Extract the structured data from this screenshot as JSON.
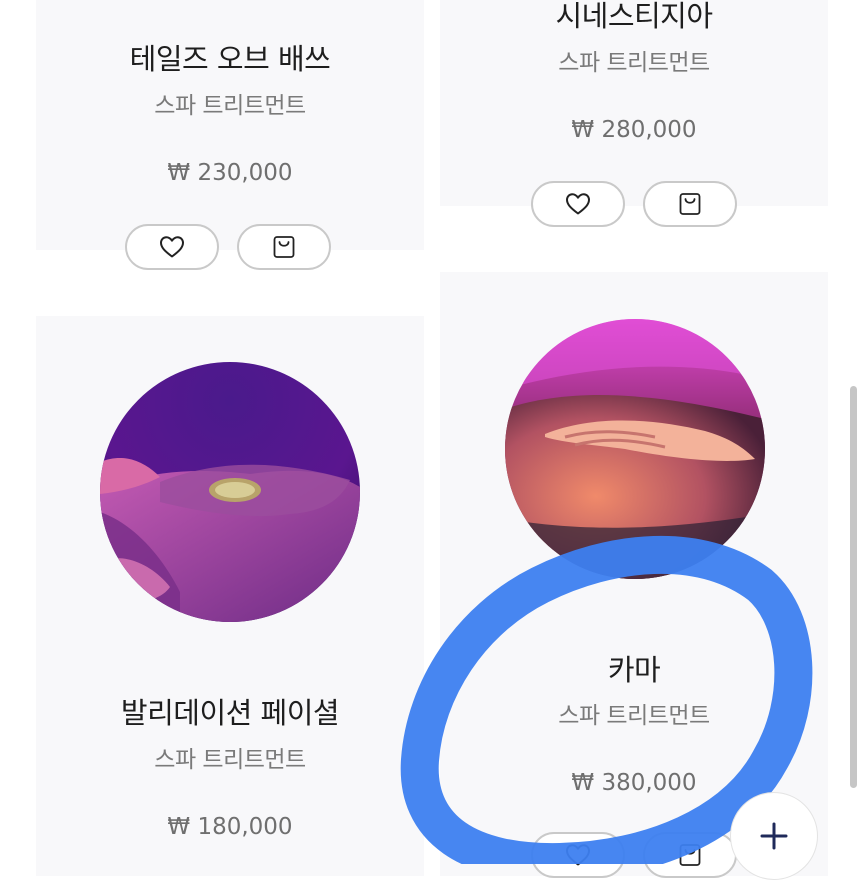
{
  "products": [
    {
      "title": "테일즈 오브 배쓰",
      "category": "스파 트리트먼트",
      "price": "₩ 230,000",
      "wishlist_icon": "heart-icon",
      "cart_icon": "shopping-bag-icon"
    },
    {
      "title": "시네스티지아",
      "category": "스파 트리트먼트",
      "price": "₩ 280,000",
      "wishlist_icon": "heart-icon",
      "cart_icon": "shopping-bag-icon"
    },
    {
      "title": "발리데이션 페이셜",
      "category": "스파 트리트먼트",
      "price": "₩ 180,000",
      "image": "facial-treatment-photo"
    },
    {
      "title": "카마",
      "category": "스파 트리트먼트",
      "price": "₩ 380,000",
      "image": "back-massage-photo",
      "wishlist_icon": "heart-icon",
      "cart_icon": "shopping-bag-icon"
    }
  ],
  "fab": {
    "icon": "plus-icon"
  },
  "colors": {
    "card_bg": "#f8f8fa",
    "annotation_stroke": "#3d7ff0"
  }
}
